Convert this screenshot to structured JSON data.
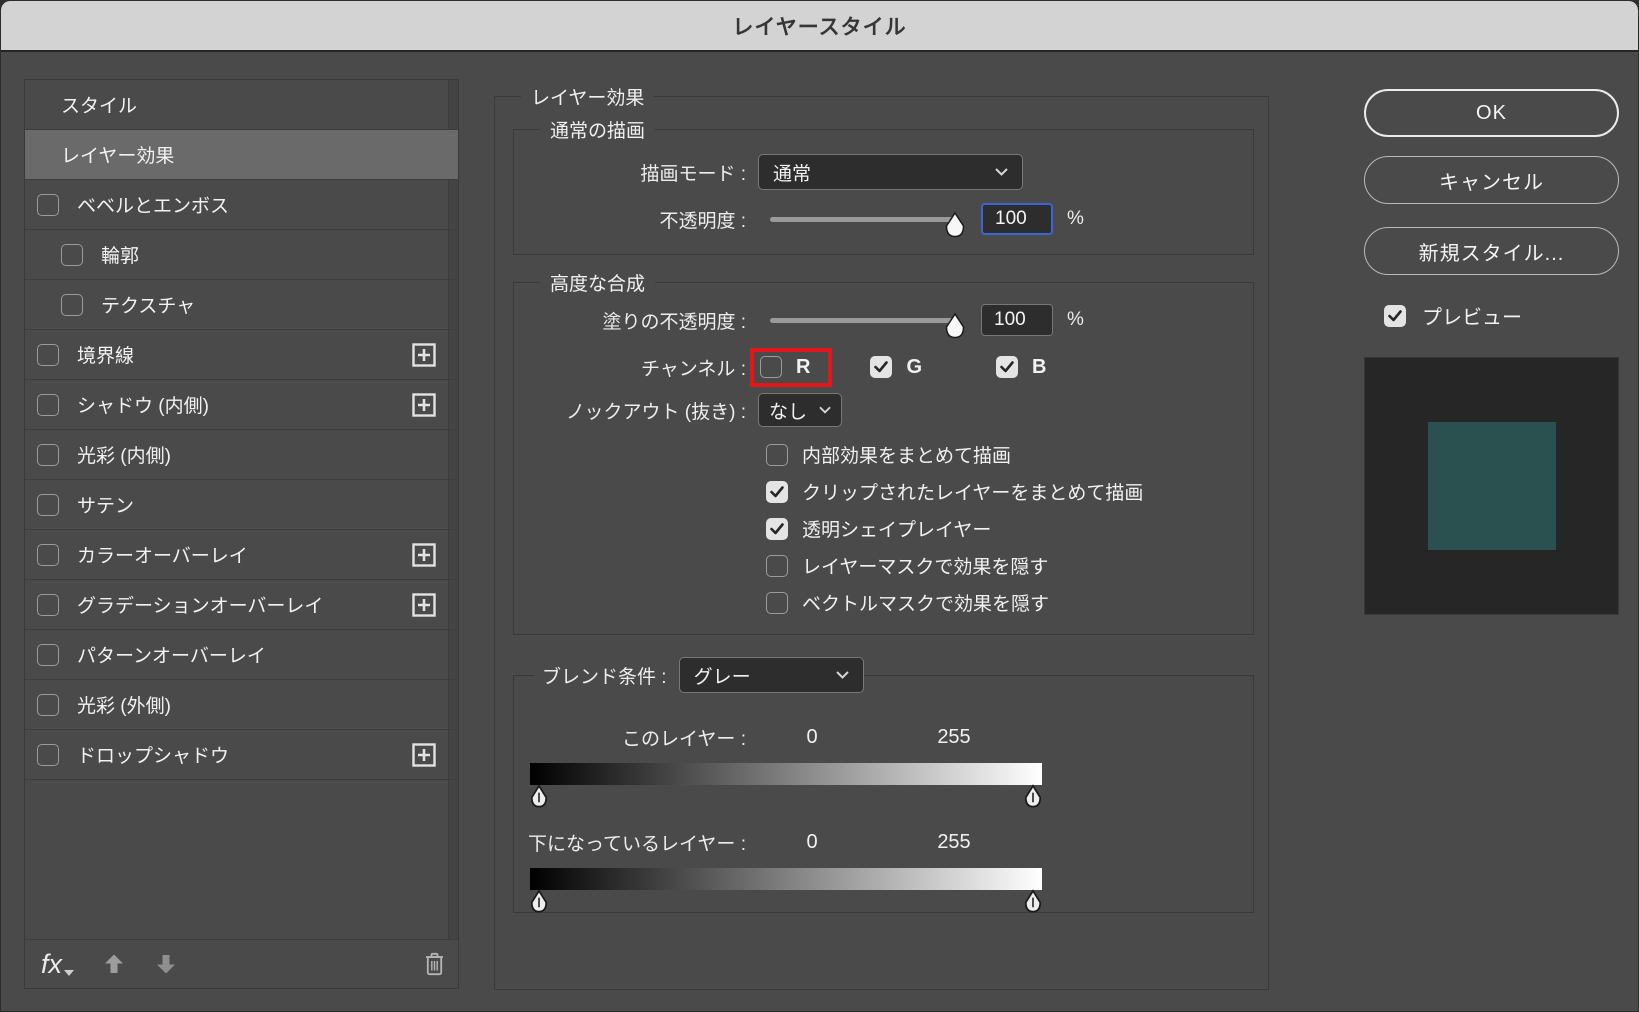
{
  "title": "レイヤースタイル",
  "colors": {
    "dialog_bg": "#4a4a4a",
    "titlebar_bg": "#d3d3d3",
    "selected_row_bg": "#6a6a6a",
    "panel_border": "#3a3a3a",
    "focus_blue": "#3c64d9",
    "highlight_red": "#e4161b",
    "preview_bg": "#262626",
    "preview_square_teal": "#2a5150"
  },
  "sidebar": {
    "items": [
      {
        "label": "スタイル",
        "checkbox": false,
        "selected": false
      },
      {
        "label": "レイヤー効果",
        "checkbox": false,
        "selected": true
      },
      {
        "label": "ベベルとエンボス",
        "checkbox": true,
        "checked": false
      },
      {
        "label": "輪郭",
        "checkbox": true,
        "checked": false,
        "indent": true
      },
      {
        "label": "テクスチャ",
        "checkbox": true,
        "checked": false,
        "indent": true
      },
      {
        "label": "境界線",
        "checkbox": true,
        "checked": false,
        "plus": true
      },
      {
        "label": "シャドウ (内側)",
        "checkbox": true,
        "checked": false,
        "plus": true
      },
      {
        "label": "光彩 (内側)",
        "checkbox": true,
        "checked": false
      },
      {
        "label": "サテン",
        "checkbox": true,
        "checked": false
      },
      {
        "label": "カラーオーバーレイ",
        "checkbox": true,
        "checked": false,
        "plus": true
      },
      {
        "label": "グラデーションオーバーレイ",
        "checkbox": true,
        "checked": false,
        "plus": true
      },
      {
        "label": "パターンオーバーレイ",
        "checkbox": true,
        "checked": false
      },
      {
        "label": "光彩 (外側)",
        "checkbox": true,
        "checked": false
      },
      {
        "label": "ドロップシャドウ",
        "checkbox": true,
        "checked": false,
        "plus": true
      }
    ],
    "footer": {
      "fx_label": "fx"
    }
  },
  "main": {
    "legend": "レイヤー効果",
    "general": {
      "legend": "通常の描画",
      "blend_mode_label": "描画モード :",
      "blend_mode_value": "通常",
      "opacity_label": "不透明度 :",
      "opacity_value": "100",
      "opacity_unit": "%"
    },
    "advanced": {
      "legend": "高度な合成",
      "fill_opacity_label": "塗りの不透明度 :",
      "fill_opacity_value": "100",
      "fill_opacity_unit": "%",
      "channels_label": "チャンネル :",
      "channels": [
        {
          "label": "R",
          "checked": false,
          "highlighted": true
        },
        {
          "label": "G",
          "checked": true,
          "highlighted": false
        },
        {
          "label": "B",
          "checked": true,
          "highlighted": false
        }
      ],
      "knockout_label": "ノックアウト (抜き) :",
      "knockout_value": "なし",
      "options": [
        {
          "label": "内部効果をまとめて描画",
          "checked": false
        },
        {
          "label": "クリップされたレイヤーをまとめて描画",
          "checked": true
        },
        {
          "label": "透明シェイプレイヤー",
          "checked": true
        },
        {
          "label": "レイヤーマスクで効果を隠す",
          "checked": false
        },
        {
          "label": "ベクトルマスクで効果を隠す",
          "checked": false
        }
      ]
    },
    "blend_if": {
      "legend": "ブレンド条件 :",
      "mode_value": "グレー",
      "this_layer_label": "このレイヤー :",
      "this_layer_min": "0",
      "this_layer_max": "255",
      "underlying_label": "下になっているレイヤー :",
      "underlying_min": "0",
      "underlying_max": "255"
    }
  },
  "actions": {
    "ok": "OK",
    "cancel": "キャンセル",
    "new_style": "新規スタイル...",
    "preview_label": "プレビュー",
    "preview_checked": true
  }
}
